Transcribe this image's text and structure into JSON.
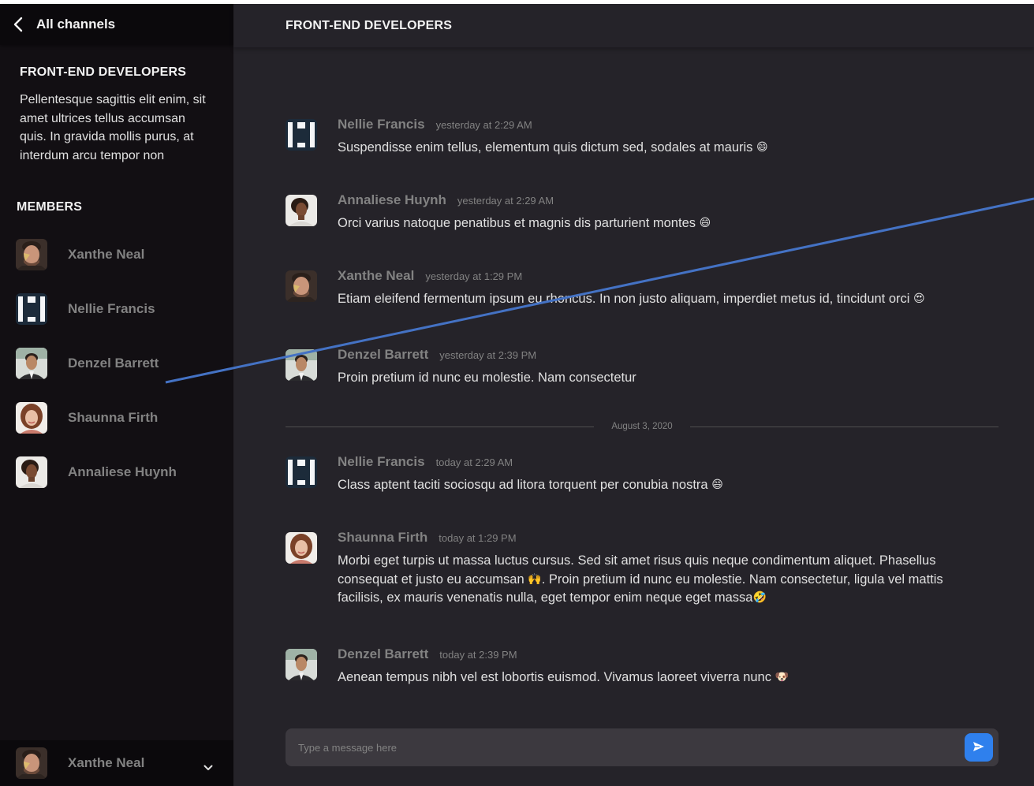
{
  "sidebar": {
    "back_label": "All channels",
    "channel": {
      "title": "FRONT-END DEVELOPERS",
      "description": "Pellentesque sagittis elit enim, sit amet ultrices tellus accumsan quis. In gravida mollis purus, at interdum arcu tempor non"
    },
    "members_title": "MEMBERS",
    "members": [
      {
        "name": "Xanthe Neal",
        "avatar": "xanthe"
      },
      {
        "name": "Nellie Francis",
        "avatar": "nellie"
      },
      {
        "name": "Denzel Barrett",
        "avatar": "denzel"
      },
      {
        "name": "Shaunna Firth",
        "avatar": "shaunna"
      },
      {
        "name": "Annaliese Huynh",
        "avatar": "annaliese"
      }
    ],
    "current_user": {
      "name": "Xanthe Neal",
      "avatar": "xanthe"
    }
  },
  "main": {
    "title": "FRONT-END DEVELOPERS",
    "messages": [
      {
        "author": "Nellie Francis",
        "avatar": "nellie",
        "time": "yesterday at 2:29 AM",
        "text": "Suspendisse enim tellus, elementum quis dictum sed, sodales at mauris",
        "emoji": "😄"
      },
      {
        "author": "Annaliese Huynh",
        "avatar": "annaliese",
        "time": "yesterday at 2:29 AM",
        "text": "Orci varius natoque penatibus et magnis dis parturient montes",
        "emoji": "😄"
      },
      {
        "author": "Xanthe Neal",
        "avatar": "xanthe",
        "time": "yesterday at 1:29 PM",
        "text": "Etiam eleifend fermentum ipsum eu rhoncus. In non justo aliquam, imperdiet metus id, tincidunt orci",
        "emoji": "😍"
      },
      {
        "author": "Denzel Barrett",
        "avatar": "denzel",
        "time": "yesterday at 2:39 PM",
        "text": "Proin pretium id nunc eu molestie. Nam consectetur",
        "emoji": ""
      },
      {
        "author": "Nellie Francis",
        "avatar": "nellie",
        "time": "today at 2:29 AM",
        "text": "Class aptent taciti sociosqu ad litora torquent per conubia nostra",
        "emoji": "😄"
      },
      {
        "author": "Shaunna Firth",
        "avatar": "shaunna",
        "time": "today at 1:29 PM",
        "text": "Morbi eget turpis ut massa luctus cursus. Sed sit amet risus quis neque condimentum aliquet. Phasellus consequat et justo eu accumsan",
        "emoji": "🙌",
        "text2": ". Proin pretium id nunc eu molestie. Nam consectetur, ligula vel mattis facilisis, ex mauris venenatis nulla, eget tempor enim neque eget massa",
        "emoji2": "🤣"
      },
      {
        "author": "Denzel Barrett",
        "avatar": "denzel",
        "time": "today at 2:39 PM",
        "text": "Aenean tempus nibh vel est lobortis euismod. Vivamus laoreet viverra nunc",
        "emoji": "🐶"
      }
    ],
    "date_divider": "August 3, 2020",
    "composer": {
      "placeholder": "Type a message here"
    }
  },
  "colors": {
    "sidebar_bg": "#120f13",
    "header_bg": "#0b090c",
    "main_bg": "#252329",
    "composer_bg": "#3c393f",
    "accent": "#2f80ed",
    "muted_text": "#828282",
    "text": "#e0e0e0",
    "overlay_line": "#4472c4"
  },
  "icons": {
    "back": "chevron-left-icon",
    "menu": "chevron-down-icon",
    "send": "send-icon"
  }
}
